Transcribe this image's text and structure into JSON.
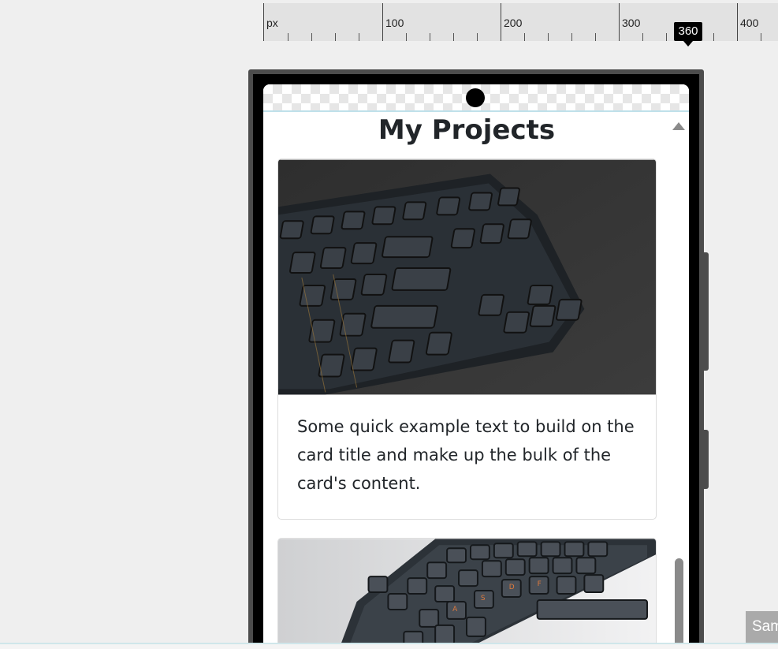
{
  "ruler": {
    "unit": "px",
    "labels": [
      "100",
      "200",
      "300",
      "400"
    ],
    "marker": "360"
  },
  "page": {
    "title": "My Projects"
  },
  "cards": [
    {
      "image_icon": "keyboard-photo-dark",
      "text": "Some quick example text to build on the card title and make up the bulk of the card's content."
    },
    {
      "image_icon": "keyboard-photo-light"
    }
  ],
  "footer": {
    "corner_tag": "Sam"
  },
  "colors": {
    "title": "#212529",
    "scrollbar": "#8a8a8a",
    "device_frame": "#4c4c4c"
  }
}
